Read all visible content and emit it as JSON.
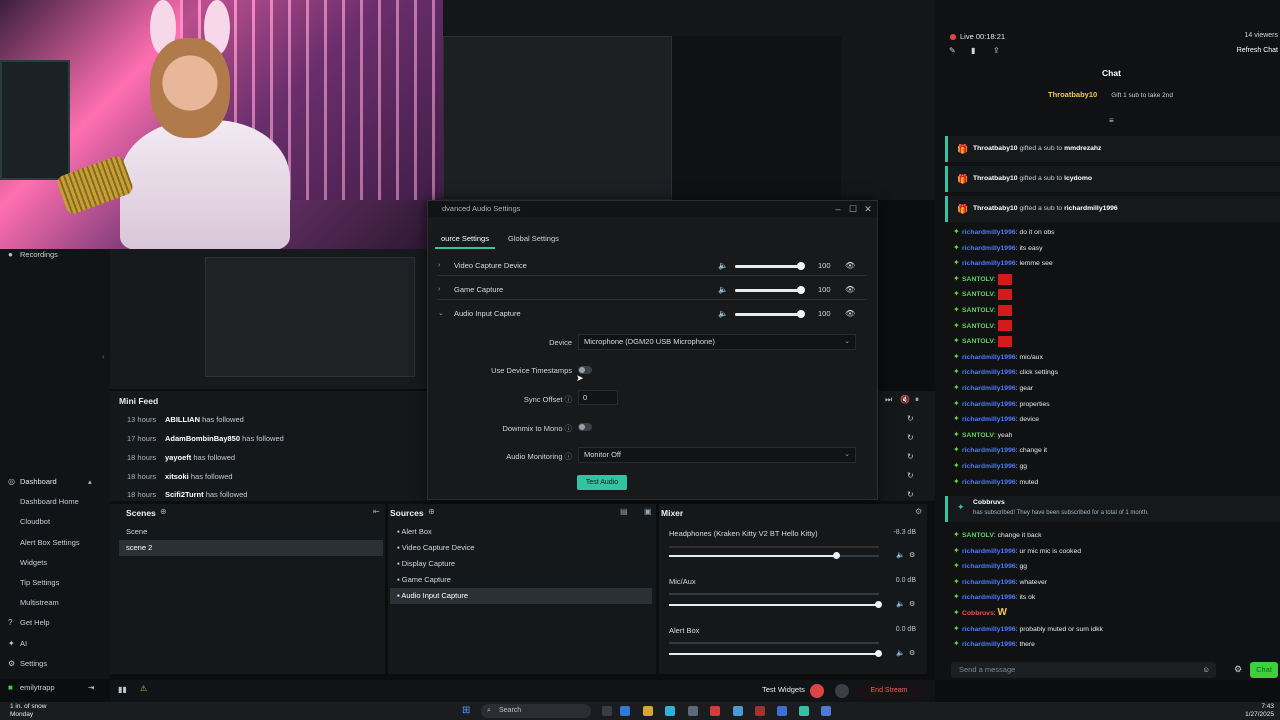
{
  "dialog": {
    "title": "dvanced Audio Settings",
    "tabs": [
      "ource Settings",
      "Global Settings"
    ],
    "sources": [
      {
        "name": "Video Capture Device",
        "volume": "100",
        "expanded": false
      },
      {
        "name": "Game Capture",
        "volume": "100",
        "expanded": false
      },
      {
        "name": "Audio Input Capture",
        "volume": "100",
        "expanded": true
      }
    ],
    "props": {
      "device_label": "Device",
      "device_value": "Microphone (DGM20 USB Microphone)",
      "timestamps_label": "Use Device Timestamps",
      "sync_label": "Sync Offset",
      "sync_value": "0",
      "mono_label": "Downmix to Mono",
      "monitoring_label": "Audio Monitoring",
      "monitoring_value": "Monitor Off",
      "test_button": "Test Audio"
    }
  },
  "sidebar": {
    "recordings": "Recordings",
    "dashboard": "Dashboard",
    "items": [
      "Dashboard Home",
      "Cloudbot",
      "Alert Box Settings",
      "Widgets",
      "Tip Settings",
      "Multistream"
    ],
    "get_help": "Get Help",
    "ai": "AI",
    "settings": "Settings",
    "user": "emilytrapp"
  },
  "minifeed": {
    "title": "Mini Feed",
    "rows": [
      {
        "time": "13 hours",
        "name": "ABILLIAN",
        "action": "has followed"
      },
      {
        "time": "17 hours",
        "name": "AdamBombinBay850",
        "action": "has followed"
      },
      {
        "time": "18 hours",
        "name": "yayoeft",
        "action": "has followed"
      },
      {
        "time": "18 hours",
        "name": "xitsoki",
        "action": "has followed"
      },
      {
        "time": "18 hours",
        "name": "Scifi2Turnt",
        "action": "has followed"
      }
    ]
  },
  "scenes": {
    "title": "Scenes",
    "items": [
      "Scene",
      "scene 2"
    ],
    "selected": 1
  },
  "sources": {
    "title": "Sources",
    "items": [
      "Alert Box",
      "Video Capture Device",
      "Display Capture",
      "Game Capture",
      "Audio Input Capture"
    ],
    "selected": 4
  },
  "mixer": {
    "title": "Mixer",
    "channels": [
      {
        "name": "Headphones (Kraken Kitty V2 BT Hello Kitty)",
        "db": "-8.3 dB",
        "level": 0.8
      },
      {
        "name": "Mic/Aux",
        "db": "0.0 dB",
        "level": 1.0
      },
      {
        "name": "Alert Box",
        "db": "0.0 dB",
        "level": 1.0
      }
    ]
  },
  "footer": {
    "test_widgets": "Test Widgets",
    "end_stream": "End Stream"
  },
  "chat": {
    "live": "Live 00:18:21",
    "viewers": "14 viewers",
    "refresh": "Refresh Chat",
    "title": "Chat",
    "pinned_user": "Throatbaby10",
    "pinned_msg": "Gift 1 sub to take 2nd",
    "events": [
      {
        "user": "Throatbaby10",
        "text": "gifted a sub to",
        "target": "mmdrezahz"
      },
      {
        "user": "Throatbaby10",
        "text": "gifted a sub to",
        "target": "lcydomo"
      },
      {
        "user": "Throatbaby10",
        "text": "gifted a sub to",
        "target": "richardmilly1996"
      }
    ],
    "messages": [
      {
        "user": "richardmilly1996",
        "text": "do it on obs",
        "color": "#4a7cff"
      },
      {
        "user": "richardmilly1996",
        "text": "its easy",
        "color": "#4a7cff"
      },
      {
        "user": "richardmilly1996",
        "text": "lemme see",
        "color": "#4a7cff"
      },
      {
        "user": "SANTOLV",
        "text": "",
        "color": "#5fd35f",
        "red": true
      },
      {
        "user": "SANTOLV",
        "text": "",
        "color": "#5fd35f",
        "red": true
      },
      {
        "user": "SANTOLV",
        "text": "",
        "color": "#5fd35f",
        "red": true
      },
      {
        "user": "SANTOLV",
        "text": "",
        "color": "#5fd35f",
        "red": true
      },
      {
        "user": "SANTOLV",
        "text": "",
        "color": "#5fd35f",
        "red": true
      },
      {
        "user": "richardmilly1996",
        "text": "mic/aux",
        "color": "#4a7cff"
      },
      {
        "user": "richardmilly1996",
        "text": "click settings",
        "color": "#4a7cff"
      },
      {
        "user": "richardmilly1996",
        "text": "gear",
        "color": "#4a7cff"
      },
      {
        "user": "richardmilly1996",
        "text": "properties",
        "color": "#4a7cff"
      },
      {
        "user": "richardmilly1996",
        "text": "device",
        "color": "#4a7cff"
      },
      {
        "user": "SANTOLV",
        "text": "yeah",
        "color": "#5fd35f"
      },
      {
        "user": "richardmilly1996",
        "text": "change it",
        "color": "#4a7cff"
      },
      {
        "user": "richardmilly1996",
        "text": "gg",
        "color": "#4a7cff"
      },
      {
        "user": "richardmilly1996",
        "text": "muted",
        "color": "#4a7cff"
      }
    ],
    "sub_user": "Cobbruvs",
    "sub_text": "has subscribed! They have been subscribed for a total of 1 month.",
    "messages2": [
      {
        "user": "SANTOLV",
        "text": "change it back",
        "color": "#5fd35f"
      },
      {
        "user": "richardmilly1996",
        "text": "ur mic mic is cooked",
        "color": "#4a7cff"
      },
      {
        "user": "richardmilly1996",
        "text": "gg",
        "color": "#4a7cff"
      },
      {
        "user": "richardmilly1996",
        "text": "whatever",
        "color": "#4a7cff"
      },
      {
        "user": "richardmilly1996",
        "text": "its ok",
        "color": "#4a7cff"
      },
      {
        "user": "Cobbruvs",
        "text": "",
        "color": "#ff4a4a",
        "emote": "W"
      },
      {
        "user": "richardmilly1996",
        "text": "probably muted or sum idkk",
        "color": "#4a7cff"
      },
      {
        "user": "richardmilly1996",
        "text": "there",
        "color": "#4a7cff"
      }
    ],
    "input_placeholder": "Send a message",
    "send": "Chat"
  },
  "taskbar": {
    "weather": "1 in. of snow",
    "weather2": "Monday",
    "search": "Search",
    "time": "7:43",
    "date": "1/27/2025"
  }
}
